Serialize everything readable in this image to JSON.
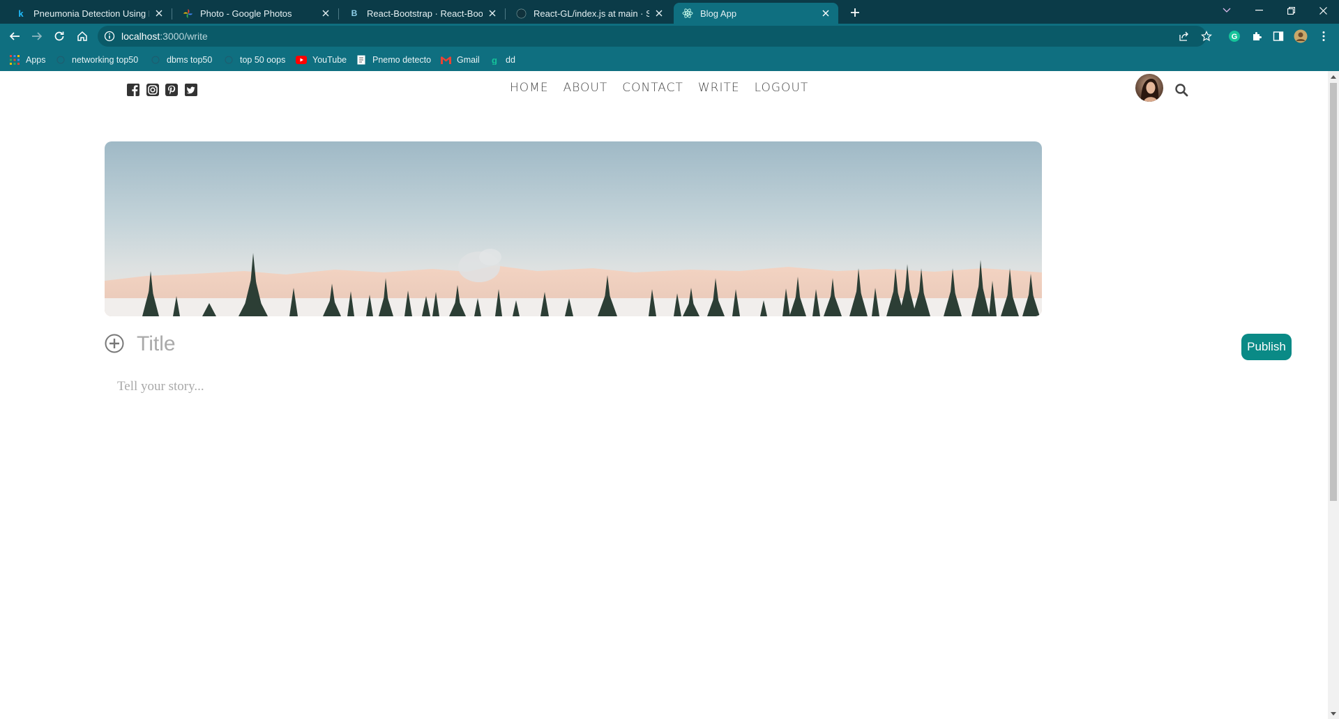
{
  "browser": {
    "tabs": [
      {
        "title": "Pneumonia Detection Using Fast",
        "icon": "kaggle-icon",
        "active": false
      },
      {
        "title": "Photo - Google Photos",
        "icon": "google-photos-icon",
        "active": false
      },
      {
        "title": "React-Bootstrap · React-Bootstrap",
        "icon": "bootstrap-icon",
        "active": false
      },
      {
        "title": "React-GL/index.js at main · Sache",
        "icon": "github-icon",
        "active": false
      },
      {
        "title": "Blog App",
        "icon": "react-icon",
        "active": true
      }
    ],
    "url_host": "localhost",
    "url_path": ":3000/write",
    "bookmarks": [
      {
        "label": "Apps",
        "icon": "apps-grid-icon"
      },
      {
        "label": "networking top50",
        "icon": "globe-icon"
      },
      {
        "label": "dbms top50",
        "icon": "globe-icon"
      },
      {
        "label": "top 50 oops",
        "icon": "globe-icon"
      },
      {
        "label": "YouTube",
        "icon": "youtube-icon"
      },
      {
        "label": "Pnemo detecto",
        "icon": "document-icon"
      },
      {
        "label": "Gmail",
        "icon": "gmail-icon"
      },
      {
        "label": "dd",
        "icon": "grammarly-icon"
      }
    ],
    "colors": {
      "tabstrip": "#0b3b48",
      "toolbar": "#0f6f80"
    }
  },
  "site": {
    "social_icons": [
      "facebook-icon",
      "instagram-icon",
      "pinterest-icon",
      "twitter-icon"
    ],
    "menu": {
      "home": "HOME",
      "about": "ABOUT",
      "contact": "CONTACT",
      "write": "WRITE",
      "logout": "LOGOUT"
    }
  },
  "write": {
    "title_placeholder": "Title",
    "story_placeholder": "Tell your story...",
    "publish_label": "Publish",
    "accent_color": "#0a8a86"
  }
}
